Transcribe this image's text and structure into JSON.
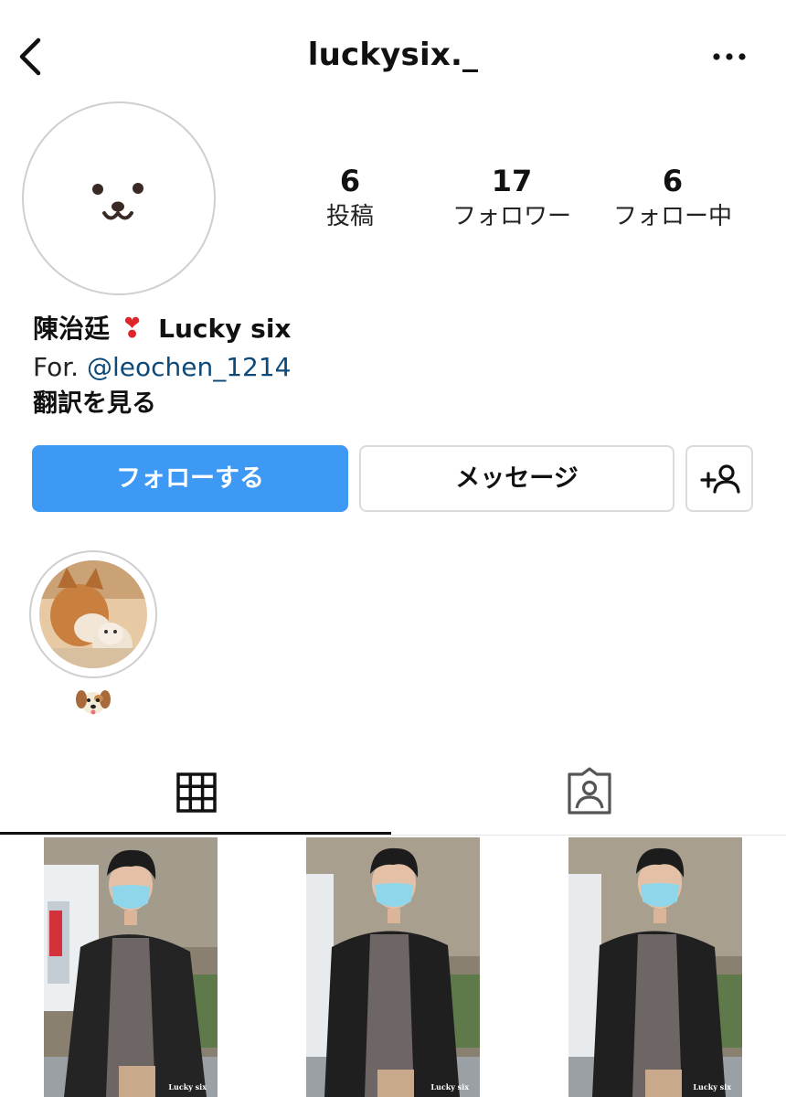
{
  "header": {
    "username": "luckysix._",
    "back_icon": "chevron-left-icon",
    "more_icon": "more-horizontal-icon"
  },
  "profile": {
    "avatar_icon": "dog-face-avatar",
    "stats": [
      {
        "count": "6",
        "label": "投稿"
      },
      {
        "count": "17",
        "label": "フォロワー"
      },
      {
        "count": "6",
        "label": "フォロー中"
      }
    ],
    "display_name": "陳治廷",
    "name_suffix": "Lucky six",
    "bio_prefix": "For. ",
    "bio_mention": "@leochen_1214",
    "translate_label": "翻訳を見る"
  },
  "actions": {
    "follow_label": "フォローする",
    "message_label": "メッセージ",
    "add_user_icon": "add-user-icon"
  },
  "highlights": [
    {
      "label_icon": "dog-face-emoji"
    }
  ],
  "tabs": [
    {
      "name": "grid",
      "icon": "grid-icon",
      "active": true
    },
    {
      "name": "tagged",
      "icon": "tagged-person-icon",
      "active": false
    }
  ],
  "posts": [
    {
      "watermark": "Lucky six"
    },
    {
      "watermark": "Lucky six"
    },
    {
      "watermark": "Lucky six"
    }
  ],
  "colors": {
    "follow_button": "#3e99f4",
    "mention_link": "#0d4a7a",
    "heart": "#e0242c"
  }
}
